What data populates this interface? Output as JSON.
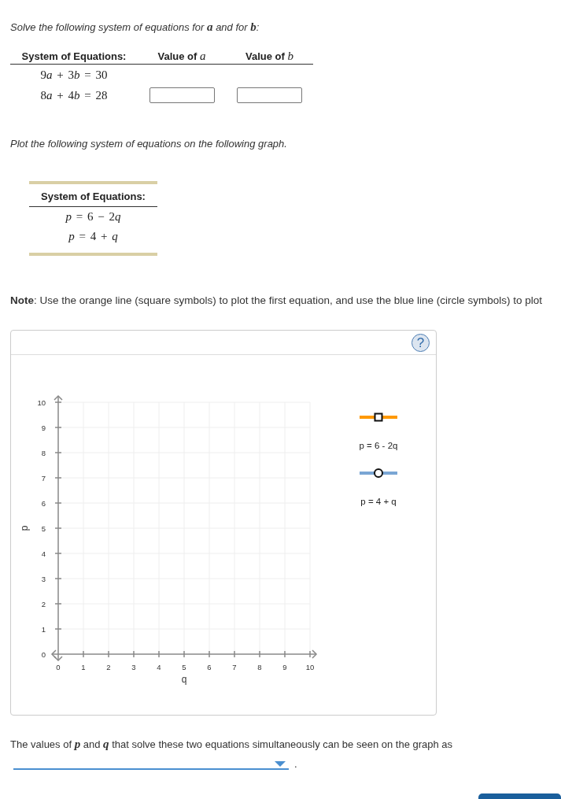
{
  "intro": "Solve the following system of equations for **a** and for **b**:",
  "system_table": {
    "columns": [
      "System of Equations:",
      "Value of *a*",
      "Value of *b*"
    ],
    "rows": [
      "9a + 3b = 30",
      "8a + 4b = 28"
    ]
  },
  "plot_intro": "Plot the following system of equations on the following graph.",
  "plot_system": {
    "heading": "System of Equations:",
    "rows": [
      "p = 6 − 2q",
      "p = 4 + q"
    ]
  },
  "note": "**Note**: Use the orange line (square symbols) to plot the first equation, and use the blue line (circle symbols) to plot",
  "graph": {
    "help_button": "?",
    "y_axis": {
      "title": "p",
      "ticks": [
        "10",
        "9",
        "8",
        "7",
        "6",
        "5",
        "4",
        "3",
        "2",
        "1",
        "0"
      ]
    },
    "x_axis": {
      "title": "q",
      "ticks": [
        "0",
        "1",
        "2",
        "3",
        "4",
        "5",
        "6",
        "7",
        "8",
        "9",
        "10"
      ]
    },
    "legend": [
      {
        "label": "p = 6 - 2q",
        "color": "#ff9900",
        "kind": "square"
      },
      {
        "label": "p = 4 + q",
        "color": "#7aa6d4",
        "kind": "circle"
      }
    ]
  },
  "conclusion": {
    "text": "The values of **p** and **q** that solve these two equations simultaneously can be seen on the graph as",
    "after_dropdown": "."
  }
}
